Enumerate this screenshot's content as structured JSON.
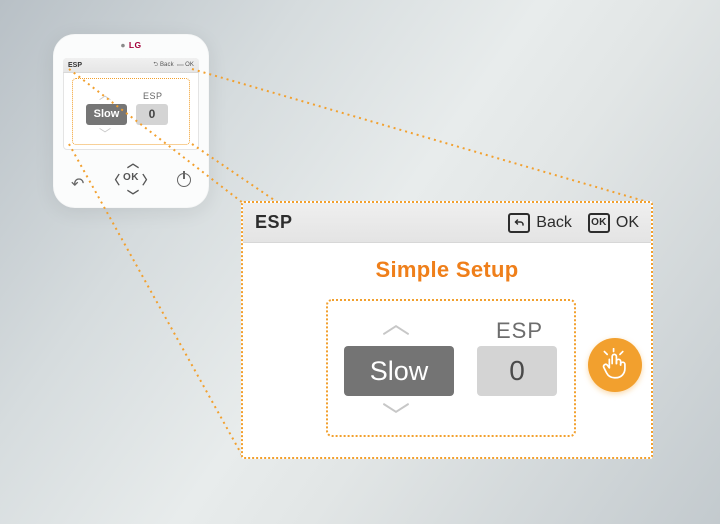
{
  "brand": "LG",
  "controller": {
    "screen_title": "ESP",
    "back_label": "Back",
    "ok_label": "OK",
    "speed_value": "Slow",
    "esp_label": "ESP",
    "esp_value": "0",
    "hw_ok": "OK"
  },
  "zoom": {
    "title": "ESP",
    "back_label": "Back",
    "ok_label": "OK",
    "subhead": "Simple Setup",
    "speed_value": "Slow",
    "esp_label": "ESP",
    "esp_value": "0",
    "ok_icon_text": "OK"
  },
  "colors": {
    "accent": "#f2a02e"
  }
}
